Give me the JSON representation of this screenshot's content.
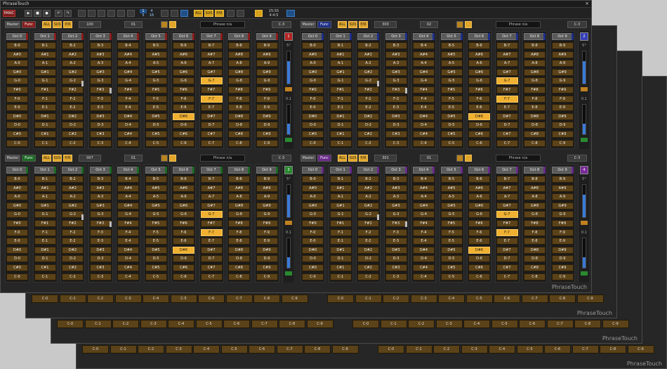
{
  "window": {
    "title": "PhraseTouch",
    "close_glyph": "×"
  },
  "brand": "PhraseTouch",
  "toolbar": {
    "panic": "PANIC",
    "transport": [
      "▶",
      "■",
      "●",
      "↶",
      "↷"
    ],
    "numbers_top": [
      "1",
      "4"
    ],
    "numbers_bottom": [
      "5",
      "16"
    ],
    "btn_all": "ALL",
    "btn_sus": "SUS",
    "btn_pr": "P/R",
    "vals": [
      "25:55",
      "4:4:5"
    ]
  },
  "panels": [
    {
      "master": "Master",
      "func": "Func",
      "func_color": "#8a1d1d",
      "tempo": "100",
      "shift": "01",
      "phrase": "Phrase n/a",
      "key": "C-3",
      "badge": "1",
      "badge_color": "#b32424"
    },
    {
      "master": "Master",
      "func": "Func",
      "func_color": "#1f2f8a",
      "tempo": "300",
      "shift": "02",
      "phrase": "Phrase n/a",
      "key": "C-3",
      "badge": "2",
      "badge_color": "#3840b8"
    },
    {
      "master": "Master",
      "func": "Func",
      "func_color": "#1d6a24",
      "tempo": "007",
      "shift": "01",
      "phrase": "Phrase n/a",
      "key": "C-3",
      "badge": "3",
      "badge_color": "#2a8a30"
    },
    {
      "master": "Master",
      "func": "Func",
      "func_color": "#6a2a8a",
      "tempo": "301",
      "shift": "01",
      "phrase": "Phrase n/a",
      "key": "C-3",
      "badge": "4",
      "badge_color": "#7a2a9a"
    }
  ],
  "octave_labels": [
    "Oct 0",
    "Oct 1",
    "Oct 2",
    "Oct 3",
    "Oct 4",
    "Oct 5",
    "Oct 6",
    "Oct 7",
    "Oct 8",
    "Oct 9"
  ],
  "notes_top": [
    "B-",
    "A#",
    "A-",
    "G#",
    "G-",
    "F#",
    "F-",
    "E-",
    "D#",
    "D-",
    "C#",
    "C-"
  ],
  "highlights": {
    "G-7": true,
    "F-7": true,
    "D#6": true
  },
  "side": {
    "top_val": "5°",
    "mid_val": "0.1"
  },
  "back_windows": [
    {
      "row_label_prefix": "C-",
      "cells": [
        "C-0",
        "C-1",
        "C-2",
        "C-3",
        "C-4",
        "C-5",
        "C-6",
        "C-7",
        "C-8",
        "C-9"
      ]
    }
  ],
  "colors": {
    "accent": "#f0b030",
    "cell": "#5b4218",
    "panic": "#7d1a1a",
    "slider": "#3a7ad8"
  }
}
